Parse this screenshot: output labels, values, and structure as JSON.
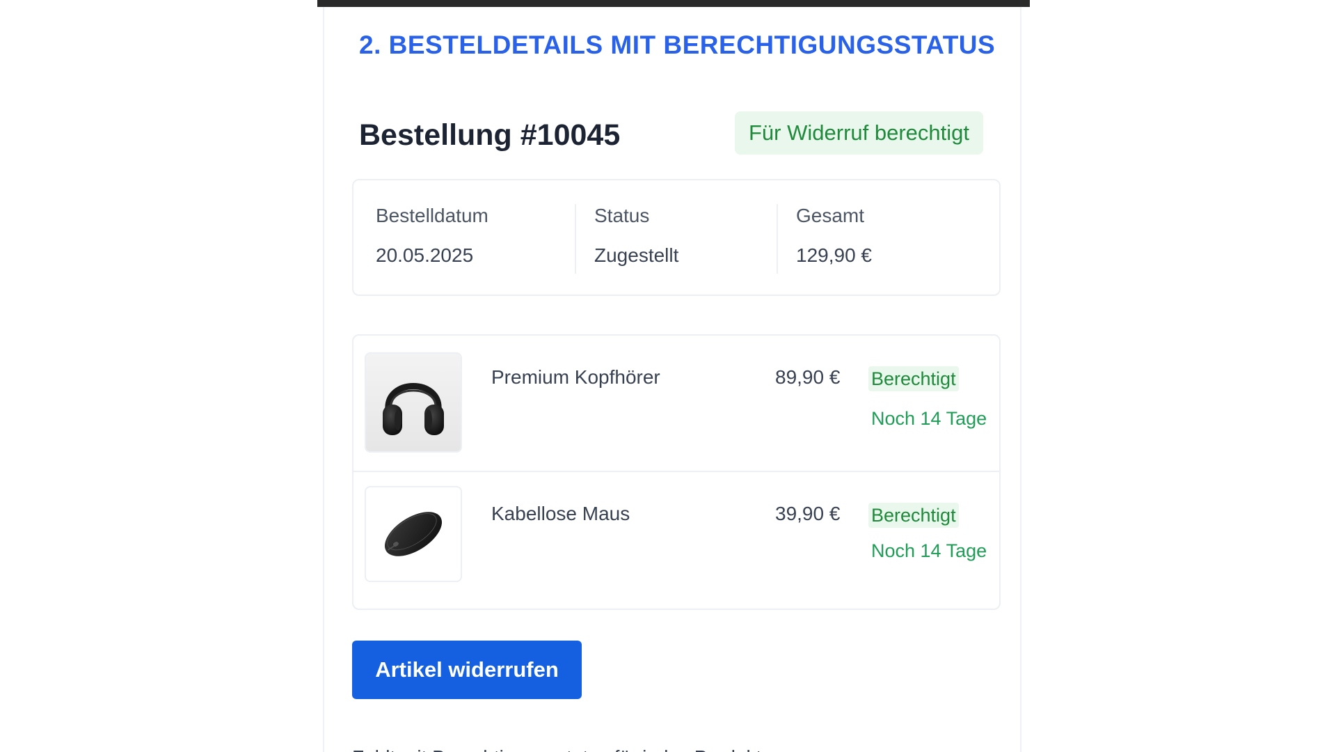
{
  "section": {
    "heading": "2. BESTELDETAILS MIT BERECHTIGUNGSSTATUS"
  },
  "order": {
    "title": "Bestellung #10045",
    "badge": "Für Widerruf berechtigt",
    "summary": [
      {
        "label": "Bestelldatum",
        "value": "20.05.2025"
      },
      {
        "label": "Status",
        "value": "Zugestellt"
      },
      {
        "label": "Gesamt",
        "value": "129,90 €"
      }
    ]
  },
  "items": [
    {
      "name": "Premium Kopfhörer",
      "price": "89,90 €",
      "status": "Berechtigt",
      "days": "Noch 14 Tage",
      "icon": "headphones-icon"
    },
    {
      "name": "Kabellose Maus",
      "price": "39,90 €",
      "status": "Berechtigt",
      "days": "Noch 14 Tage",
      "icon": "mouse-icon"
    }
  ],
  "actions": {
    "revoke_label": "Artikel widerrufen"
  },
  "footer": {
    "partial_text": "Fehlt mit Berechtigungsstatus für jedes Produkt"
  },
  "colors": {
    "accent": "#2962e8",
    "button": "#1560e0",
    "eligible_text": "#1f8a3b",
    "eligible_bg": "#e9f7ec"
  }
}
